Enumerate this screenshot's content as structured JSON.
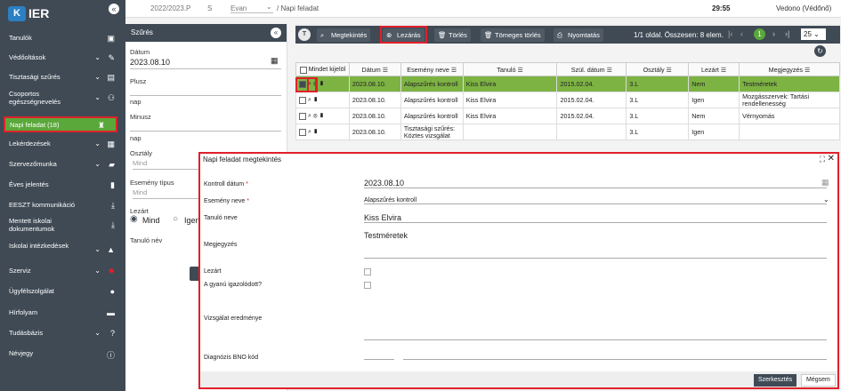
{
  "app": {
    "logo_letter": "K",
    "logo_text": "IER",
    "collapse": "«"
  },
  "topbar": {
    "year": "2022/2023.P",
    "s": "S",
    "evan": "Evan",
    "breadcrumb": "/ Napi feladat",
    "time": "29:55",
    "user": "Vedono (Védőnő)"
  },
  "sidebar": {
    "items": [
      {
        "label": "Tanulók",
        "icon": "id-card-icon",
        "chev": false
      },
      {
        "label": "Védőoltások",
        "icon": "syringe-icon",
        "chev": true
      },
      {
        "label": "Tisztasági szűrés",
        "icon": "clipboard-icon",
        "chev": true
      },
      {
        "label": "Csoportos egészségnevelés",
        "icon": "group-icon",
        "chev": true
      },
      {
        "label": "Napi feladat  (18)",
        "icon": "bell-icon",
        "chev": false,
        "active": true
      },
      {
        "label": "Lekérdezések",
        "icon": "list-icon",
        "chev": true
      },
      {
        "label": "Szervezőmunka",
        "icon": "briefcase-icon",
        "chev": true
      },
      {
        "label": "Éves jelentés",
        "icon": "doc-icon",
        "chev": false
      },
      {
        "label": "EESZT kommunikáció",
        "icon": "download-icon",
        "chev": false
      },
      {
        "label": "Mentett iskolai dokumentumok",
        "icon": "download-icon",
        "chev": false
      },
      {
        "label": "Iskolai intézkedések",
        "icon": "cap-icon",
        "chev": true
      },
      {
        "label": "Szerviz",
        "icon": "gear-icon",
        "chev": true
      },
      {
        "label": "Ügyfélszolgálat",
        "icon": "user-icon",
        "chev": false
      },
      {
        "label": "Hírfolyam",
        "icon": "chat-icon",
        "chev": false
      },
      {
        "label": "Tudásbázis",
        "icon": "question-icon",
        "chev": true
      },
      {
        "label": "Névjegy",
        "icon": "info-icon",
        "chev": false
      }
    ]
  },
  "filter": {
    "title": "Szűrés",
    "collapse": "«",
    "datum_label": "Dátum",
    "datum_value": "2023.08.10",
    "plusz_label": "Plusz",
    "plusz_unit": "nap",
    "minusz_label": "Minusz",
    "minusz_unit": "nap",
    "osztaly_label": "Osztály",
    "osztaly_ph": "Mind",
    "esemeny_label": "Esemény típus",
    "esemeny_ph": "Mind",
    "lezart_label": "Lezárt",
    "radio_mind": "Mind",
    "radio_igen": "Igen",
    "tanulo_label": "Tanuló név"
  },
  "toolbar": {
    "filter_icon": "T",
    "megtekintes": "Megtekintés",
    "lezaras": "Lezárás",
    "torles": "Törlés",
    "tomeges": "Tömeges törlés",
    "nyomtatas": "Nyomtatás",
    "paging": "1/1 oldal. Összesen: 8 elem.",
    "page": "1",
    "pagesize": "25"
  },
  "table": {
    "headers": [
      "Mindet kijelöl",
      "Dátum",
      "Esemény neve",
      "Tanuló",
      "Szül. dátum",
      "Osztály",
      "Lezárt",
      "Megjegyzés"
    ],
    "rows": [
      {
        "date": "2023.08.10.",
        "event": "Alapszűrés kontroll",
        "student": "Kiss Elvira",
        "birth": "2015.02.04.",
        "class": "3.L",
        "closed": "Nem",
        "note": "Testméretek",
        "selected": true
      },
      {
        "date": "2023.08.10.",
        "event": "Alapszűrés kontroll",
        "student": "Kiss Elvira",
        "birth": "2015.02.04.",
        "class": "3.L",
        "closed": "Igen",
        "note": "Mozgásszervek: Tartási rendellenesség",
        "selected": false
      },
      {
        "date": "2023.08.10.",
        "event": "Alapszűrés kontroll",
        "student": "Kiss Elvira",
        "birth": "2015.02.04.",
        "class": "3.L",
        "closed": "Nem",
        "note": "Vérnyomás",
        "selected": false
      },
      {
        "date": "2023.08.10.",
        "event": "Tisztasági szűrés: Köztes vizsgálat",
        "student": "",
        "birth": "",
        "class": "3.L",
        "closed": "Igen",
        "note": "",
        "selected": false
      }
    ]
  },
  "modal": {
    "title": "Napi feladat megtekintés",
    "kontroll_label": "Kontroll dátum",
    "kontroll_value": "2023.08.10",
    "esemeny_label": "Esemény neve",
    "esemeny_value": "Alapszűrés kontroll",
    "tanulo_label": "Tanuló neve",
    "tanulo_value": "Kiss Elvira",
    "megj_label": "Megjegyzés",
    "megj_value": "Testméretek",
    "lezart_label": "Lezárt",
    "gyanu_label": "A gyanú igazolódott?",
    "vizsg_label": "Vizsgálat eredménye",
    "diag_label": "Diagnózis BNO kód",
    "szerk": "Szerkesztés",
    "megsem": "Mégsem"
  }
}
